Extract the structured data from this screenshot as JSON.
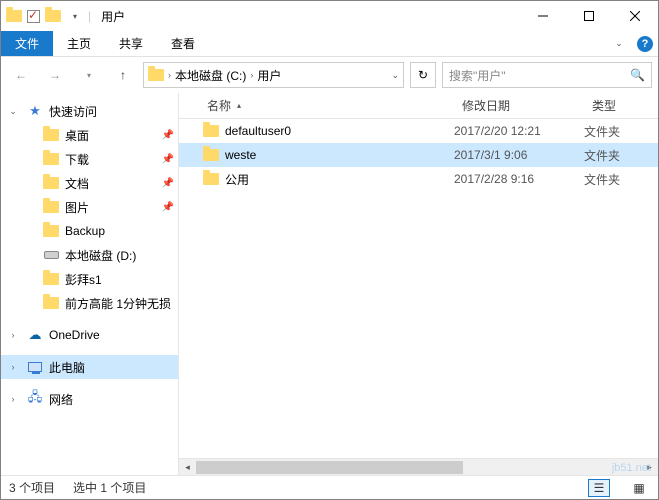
{
  "window": {
    "title": "用户"
  },
  "ribbon": {
    "file": "文件",
    "home": "主页",
    "share": "共享",
    "view": "查看"
  },
  "address": {
    "segments": [
      "本地磁盘 (C:)",
      "用户"
    ],
    "search_placeholder": "搜索\"用户\""
  },
  "nav": {
    "quick": "快速访问",
    "items": [
      {
        "label": "桌面",
        "pinned": true
      },
      {
        "label": "下载",
        "pinned": true
      },
      {
        "label": "文档",
        "pinned": true
      },
      {
        "label": "图片",
        "pinned": true
      },
      {
        "label": "Backup",
        "pinned": false
      },
      {
        "label": "本地磁盘 (D:)",
        "pinned": false,
        "drive": true
      },
      {
        "label": "彭拜s1",
        "pinned": false
      },
      {
        "label": "前方高能 1分钟无损",
        "pinned": false
      }
    ],
    "onedrive": "OneDrive",
    "thispc": "此电脑",
    "network": "网络"
  },
  "columns": {
    "name": "名称",
    "date": "修改日期",
    "type": "类型"
  },
  "rows": [
    {
      "name": "defaultuser0",
      "date": "2017/2/20 12:21",
      "type": "文件夹",
      "selected": false
    },
    {
      "name": "weste",
      "date": "2017/3/1 9:06",
      "type": "文件夹",
      "selected": true
    },
    {
      "name": "公用",
      "date": "2017/2/28 9:16",
      "type": "文件夹",
      "selected": false
    }
  ],
  "status": {
    "total": "3 个项目",
    "selected": "选中 1 个项目"
  },
  "watermark": "jb51.net"
}
